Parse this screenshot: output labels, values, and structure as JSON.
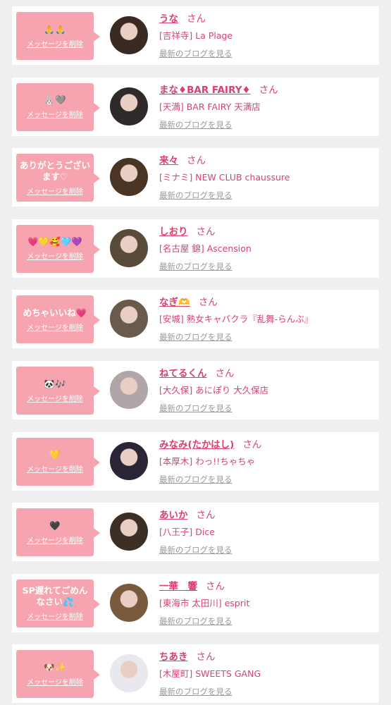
{
  "delete_label": "メッセージを削除",
  "blog_label": "最新のブログを見る",
  "honorific": "さん",
  "items": [
    {
      "message": "🙏🙏",
      "name": "うな",
      "shop": "[吉祥寺] La Plage",
      "avatar_color": "#3a2a24"
    },
    {
      "message": "🐰🩶",
      "name": "まな♦BAR FAIRY♦",
      "shop": "[天満] BAR FAIRY 天満店",
      "avatar_color": "#2e2a2a"
    },
    {
      "message": "ありがとうございます♡",
      "name": "来々",
      "shop": "[ミナミ] NEW CLUB chaussure",
      "avatar_color": "#4a3424"
    },
    {
      "message": "💗💛🥰🩵💜",
      "name": "しおり",
      "shop": "[名古屋 錦] Ascension",
      "avatar_color": "#5a4a3a"
    },
    {
      "message": "めちゃいいね💗",
      "name": "なぎ🫶",
      "shop": "[安城] 熟女キャバクラ『乱舞-らんぶ』",
      "avatar_color": "#6a5a4c"
    },
    {
      "message": "🐼🎶",
      "name": "ねてるくん",
      "shop": "[大久保] あにぽり 大久保店",
      "avatar_color": "#b0a6a8"
    },
    {
      "message": "💛",
      "name": "みなみ(たかはし)",
      "shop": "[本厚木] わっ!!ちゃちゃ",
      "avatar_color": "#2a2436"
    },
    {
      "message": "🖤",
      "name": "あいか",
      "shop": "[八王子] Dice",
      "avatar_color": "#3c2f26"
    },
    {
      "message": "SP遅れてごめんなさい💦",
      "name": "一華　響",
      "shop": "[東海市 太田川] esprit",
      "avatar_color": "#7a5a3c"
    },
    {
      "message": "🐶✨",
      "name": "ちあき",
      "shop": "[木屋町] SWEETS GANG",
      "avatar_color": "#e8e8ee"
    }
  ]
}
